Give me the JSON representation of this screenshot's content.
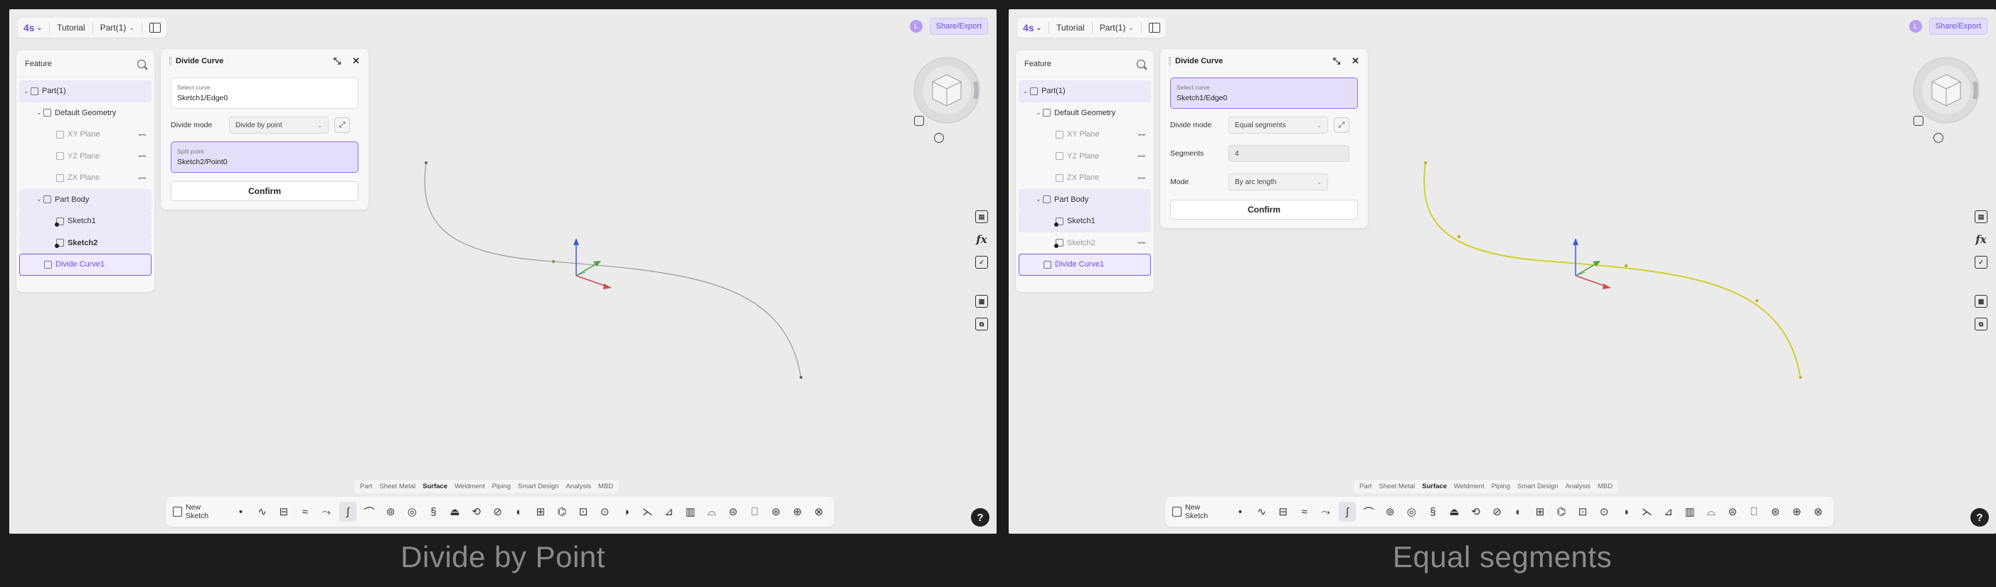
{
  "panels": [
    {
      "caption": "Divide by Point",
      "topbar": {
        "logo": "4s",
        "tutorial": "Tutorial",
        "part": "Part(1)"
      },
      "share": {
        "avatar": "L",
        "button": "Share/Export"
      },
      "feature": {
        "header": "Feature",
        "items": [
          {
            "label": "Part(1)",
            "level": 0,
            "state": "hl"
          },
          {
            "label": "Default Geometry",
            "level": 1,
            "state": ""
          },
          {
            "label": "XY Plane",
            "level": 2,
            "state": "dim"
          },
          {
            "label": "YZ Plane",
            "level": 2,
            "state": "dim"
          },
          {
            "label": "ZX Plane",
            "level": 2,
            "state": "dim"
          },
          {
            "label": "Part Body",
            "level": 1,
            "state": "hl"
          },
          {
            "label": "Sketch1",
            "level": 2,
            "state": "hl"
          },
          {
            "label": "Sketch2",
            "level": 2,
            "state": "hl bold"
          },
          {
            "label": "Divide Curve1",
            "level": 1,
            "state": "sel"
          }
        ]
      },
      "dialog": {
        "title": "Divide Curve",
        "select_curve_label": "Select curve",
        "select_curve_value": "Sketch1/Edge0",
        "divide_mode_label": "Divide mode",
        "divide_mode_value": "Divide by point",
        "split_label": "Split point",
        "split_value": "Sketch2/Point0",
        "confirm": "Confirm"
      },
      "curve_color": "#9a9a9a"
    },
    {
      "caption": "Equal segments",
      "topbar": {
        "logo": "4s",
        "tutorial": "Tutorial",
        "part": "Part(1)"
      },
      "share": {
        "avatar": "L",
        "button": "Share/Export"
      },
      "feature": {
        "header": "Feature",
        "items": [
          {
            "label": "Part(1)",
            "level": 0,
            "state": "hl"
          },
          {
            "label": "Default Geometry",
            "level": 1,
            "state": ""
          },
          {
            "label": "XY Plane",
            "level": 2,
            "state": "dim"
          },
          {
            "label": "YZ Plane",
            "level": 2,
            "state": "dim"
          },
          {
            "label": "ZX Plane",
            "level": 2,
            "state": "dim"
          },
          {
            "label": "Part Body",
            "level": 1,
            "state": "hl"
          },
          {
            "label": "Sketch1",
            "level": 2,
            "state": "hl"
          },
          {
            "label": "Sketch2",
            "level": 2,
            "state": "dim"
          },
          {
            "label": "Divide Curve1",
            "level": 1,
            "state": "sel"
          }
        ]
      },
      "dialog": {
        "title": "Divide Curve",
        "select_curve_label": "Select curve",
        "select_curve_value": "Sketch1/Edge0",
        "divide_mode_label": "Divide mode",
        "divide_mode_value": "Equal segments",
        "segments_label": "Segments",
        "segments_value": "4",
        "mode_label": "Mode",
        "mode_value": "By arc length",
        "confirm": "Confirm"
      },
      "curve_color": "#d2cf2a"
    }
  ],
  "bottom_tabs": [
    "Part",
    "Sheet Metal",
    "Surface",
    "Weldment",
    "Piping",
    "Smart Design",
    "Analysis",
    "MBD"
  ],
  "active_tab": "Surface",
  "new_sketch": "New Sketch",
  "accent_color": "#6c4fd8"
}
